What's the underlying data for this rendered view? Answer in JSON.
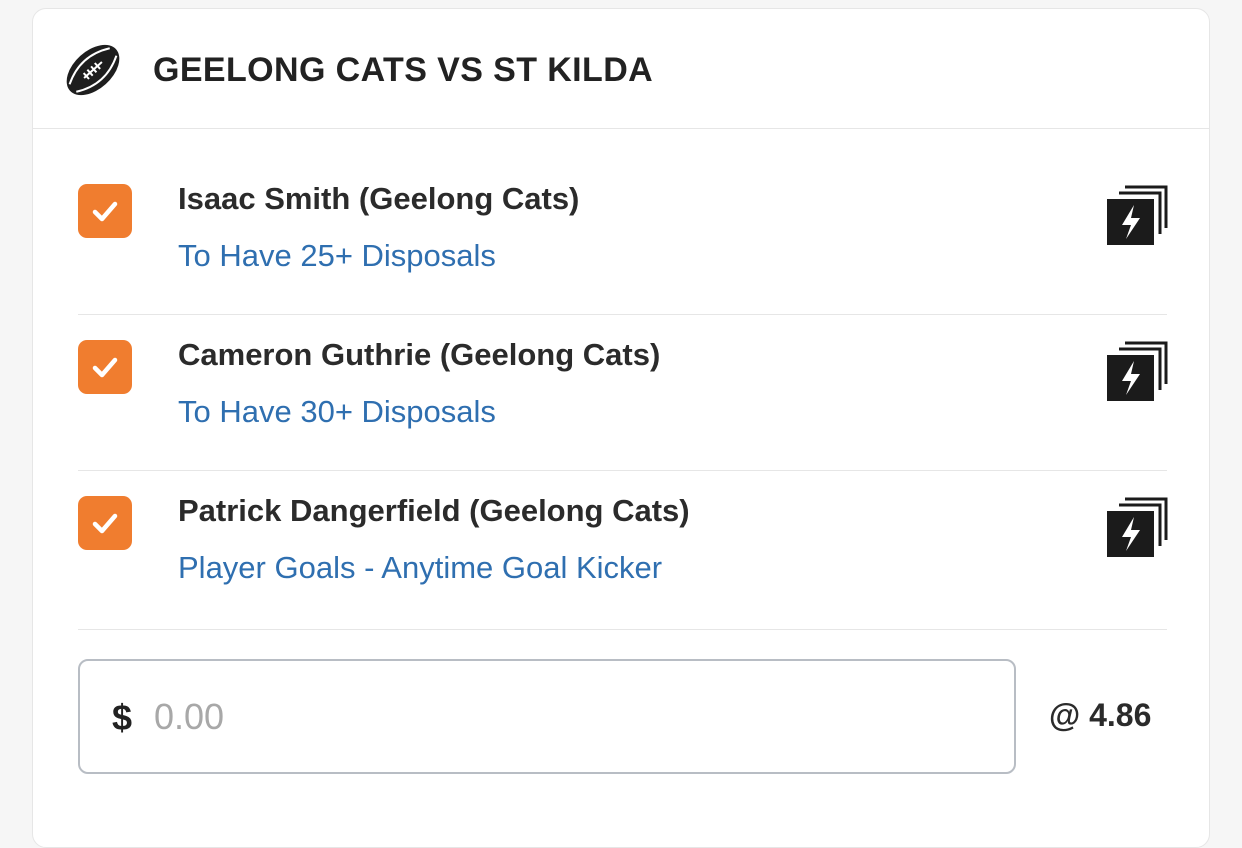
{
  "header": {
    "title": "GEELONG CATS VS ST KILDA",
    "sport_icon": "football-icon"
  },
  "selections": [
    {
      "player": "Isaac Smith (Geelong Cats)",
      "market": "To Have 25+ Disposals",
      "checked": true,
      "icon": "same-game-multi-boost-icon"
    },
    {
      "player": "Cameron Guthrie (Geelong Cats)",
      "market": "To Have 30+ Disposals",
      "checked": true,
      "icon": "same-game-multi-boost-icon"
    },
    {
      "player": "Patrick Dangerfield (Geelong Cats)",
      "market": "Player Goals - Anytime Goal Kicker",
      "checked": true,
      "icon": "same-game-multi-boost-icon"
    }
  ],
  "stake": {
    "currency": "$",
    "placeholder": "0.00",
    "value": ""
  },
  "odds_label": "@ 4.86",
  "colors": {
    "checkbox": "#f07d2f",
    "market_link": "#2f6fb0",
    "text": "#2b2b2b",
    "divider": "#e6e6e6"
  }
}
